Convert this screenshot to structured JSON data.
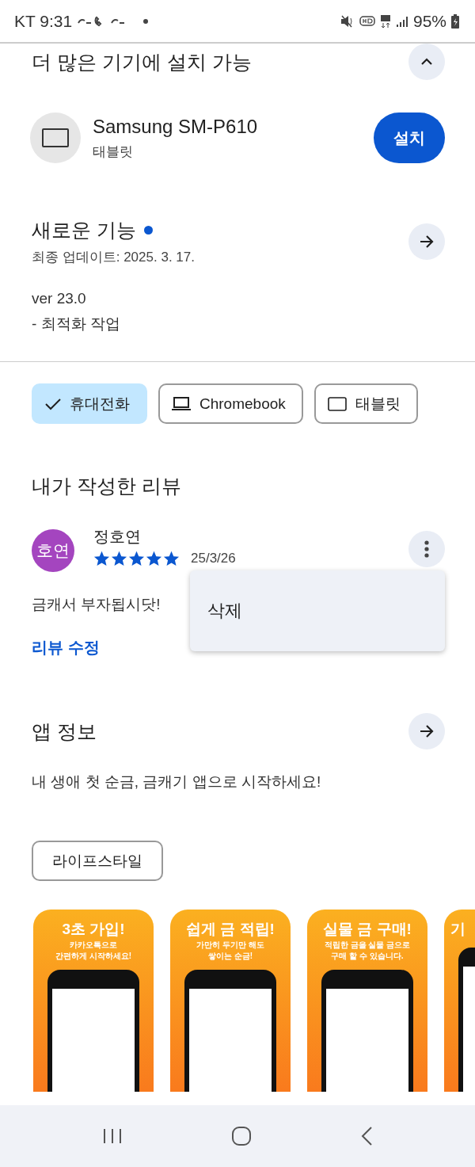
{
  "status_bar": {
    "carrier": "KT",
    "time": "9:31",
    "battery": "95%"
  },
  "install_section": {
    "title": "더 많은 기기에 설치 가능",
    "expanded": true,
    "device": {
      "name": "Samsung SM-P610",
      "type": "태블릿"
    },
    "install_button": "설치"
  },
  "whats_new": {
    "title": "새로운 기능",
    "unread": true,
    "updated": "최종 업데이트: 2025. 3. 17.",
    "lines": [
      "ver 23.0",
      "- 최적화 작업"
    ]
  },
  "device_chips": [
    {
      "label": "휴대전화",
      "selected": true
    },
    {
      "label": "Chromebook",
      "kind": "laptop",
      "selected": false
    },
    {
      "label": "태블릿",
      "kind": "tablet",
      "selected": false
    }
  ],
  "my_review": {
    "title": "내가 작성한 리뷰",
    "avatar": "호연",
    "author": "정호연",
    "stars": 5,
    "date": "25/3/26",
    "text": "금캐서 부자됩시닷!",
    "edit_link": "리뷰 수정",
    "menu": {
      "open": true,
      "items": [
        "삭제"
      ]
    }
  },
  "app_info": {
    "title": "앱 정보",
    "description": "내 생애 첫 순금, 금캐기 앱으로 시작하세요!",
    "tags": [
      "라이프스타일"
    ]
  },
  "screenshots": [
    {
      "headline": "3초 가입!",
      "caption": [
        "카카오톡으로",
        "간편하게 시작하세요!"
      ]
    },
    {
      "headline": "쉽게 금 적립!",
      "caption": [
        "가만히 두기만 해도",
        "쌓이는 순금!"
      ]
    },
    {
      "headline": "실물 금 구매!",
      "caption": [
        "적립한 금을 실물 금으로",
        "구매 할 수 있습니다."
      ]
    },
    {
      "headline": "기"
    }
  ]
}
